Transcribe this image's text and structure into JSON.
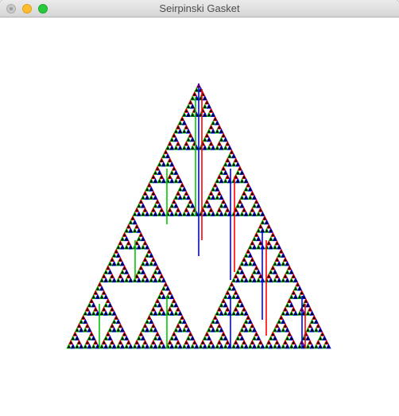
{
  "window": {
    "title": "Seirpinski Gasket"
  },
  "controls": {
    "close_icon": "close-icon",
    "minimize_icon": "minimize-icon",
    "zoom_icon": "zoom-icon"
  },
  "gasket": {
    "fill_color": "#000000",
    "edge_colors": [
      "#ff0000",
      "#00c800",
      "#0000ff"
    ],
    "background": "#ffffff",
    "recursion_depth": 6
  }
}
